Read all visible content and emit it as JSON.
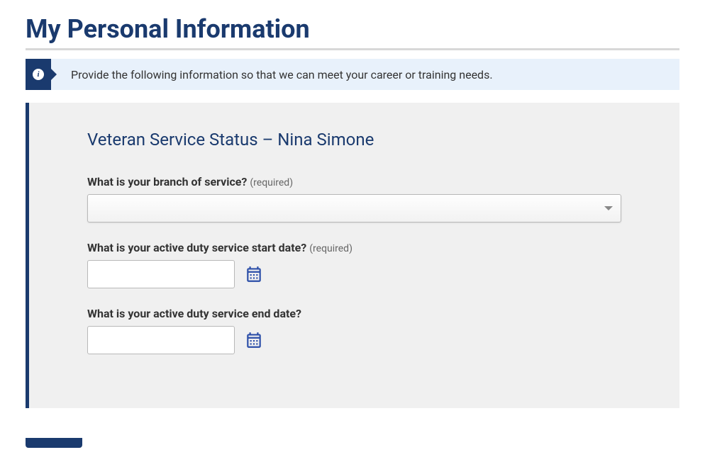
{
  "header": {
    "title": "My Personal Information"
  },
  "banner": {
    "message": "Provide the following information so that we can meet your career or training needs."
  },
  "section": {
    "heading": "Veteran Service Status – Nina Simone"
  },
  "fields": {
    "branch": {
      "label": "What is your branch of service?",
      "required_text": "(required)",
      "value": ""
    },
    "start_date": {
      "label": "What is your active duty service start date?",
      "required_text": "(required)",
      "value": ""
    },
    "end_date": {
      "label": "What is your active duty service end date?",
      "value": ""
    }
  }
}
